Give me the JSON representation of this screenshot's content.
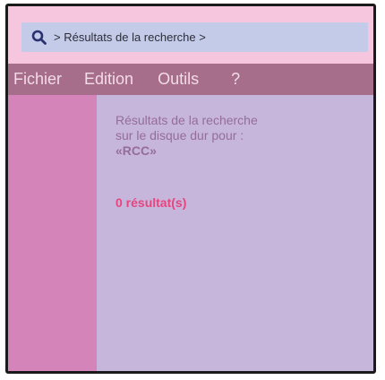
{
  "address_bar": {
    "icon": "search-icon",
    "breadcrumb": "> Résultats de la recherche >"
  },
  "menu": {
    "items": [
      "Fichier",
      "Edition",
      "Outils",
      "?"
    ]
  },
  "main": {
    "description_line1": "Résultats de la recherche",
    "description_line2": "sur le disque dur pour :",
    "query": "«RCC»",
    "result_count": "0 résultat(s)"
  },
  "colors": {
    "window_background": "#f5c6dd",
    "address_bar": "#c3cbe8",
    "menu_bar": "#a66e8b",
    "sidebar": "#d484b8",
    "content": "#c7b6dc",
    "accent_result": "#e6457e"
  }
}
